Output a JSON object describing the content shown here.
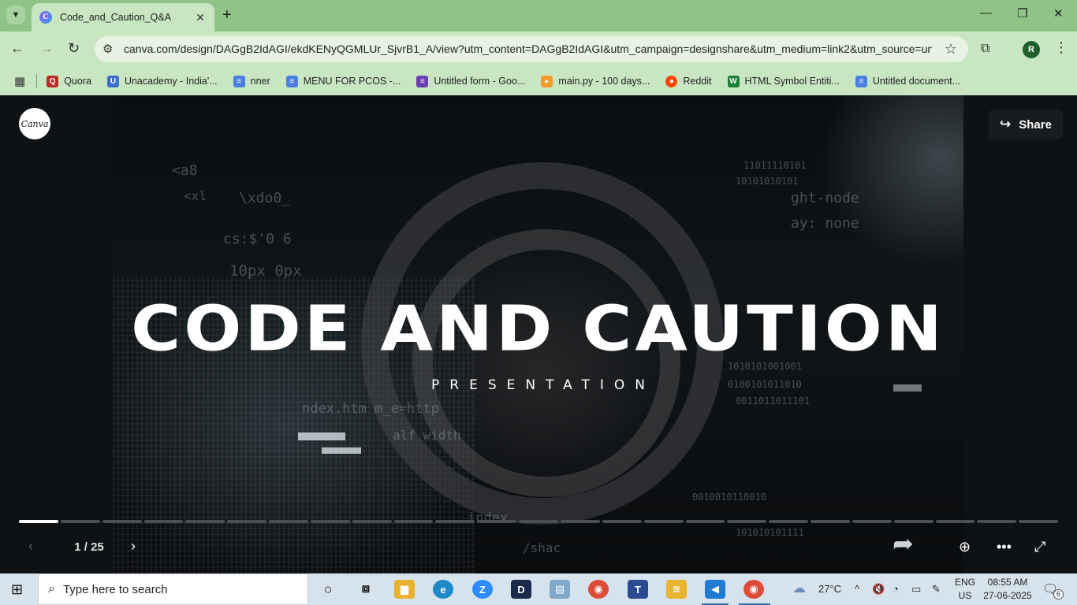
{
  "browser": {
    "tab": {
      "title": "Code_and_Caution_Q&A"
    },
    "url": "canva.com/design/DAGgB2IdAGI/ekdKENyQGMLUr_SjvrB1_A/view?utm_content=DAGgB2IdAGI&utm_campaign=designshare&utm_medium=link2&utm_source=un...",
    "profile_initial": "R",
    "bookmarks": [
      {
        "label": "Quora",
        "color": "#b92b27",
        "glyph": "Q"
      },
      {
        "label": "Unacademy - India'...",
        "color": "#3c6ec8",
        "glyph": "U"
      },
      {
        "label": "nner",
        "color": "#4a7fe0",
        "glyph": "≡"
      },
      {
        "label": "MENU FOR PCOS -...",
        "color": "#4a7fe0",
        "glyph": "≡"
      },
      {
        "label": "Untitled form - Goo...",
        "color": "#6c3fb5",
        "glyph": "≡"
      },
      {
        "label": "main.py - 100 days...",
        "color": "#f39c2a",
        "glyph": "▸"
      },
      {
        "label": "Reddit",
        "color": "#ff4500",
        "glyph": "●"
      },
      {
        "label": "HTML Symbol Entiti...",
        "color": "#1a7f37",
        "glyph": "W"
      },
      {
        "label": "Untitled document...",
        "color": "#4a7fe0",
        "glyph": "≡"
      }
    ]
  },
  "viewer": {
    "logo_text": "Canva",
    "share_label": "Share",
    "slide": {
      "title": "CODE AND CAUTION",
      "subtitle": "PRESENTATION"
    },
    "page": {
      "current": 1,
      "total": 25,
      "label": "1 / 25"
    }
  },
  "taskbar": {
    "search_placeholder": "Type here to search",
    "weather": "27°C",
    "lang_line1": "ENG",
    "lang_line2": "US",
    "time": "08:55 AM",
    "date": "27-06-2025",
    "notifications": "6",
    "apps": [
      {
        "name": "task-view",
        "color": "#333333",
        "glyph": "▭"
      },
      {
        "name": "file-explorer",
        "color": "#e8b130",
        "glyph": "▆"
      },
      {
        "name": "edge",
        "color": "#1e88c8",
        "glyph": "e"
      },
      {
        "name": "zoom",
        "color": "#2d8cff",
        "glyph": "Z"
      },
      {
        "name": "dev-tool",
        "color": "#1a2a4a",
        "glyph": "D"
      },
      {
        "name": "notepad-app",
        "color": "#7fa8c9",
        "glyph": "▤"
      },
      {
        "name": "chrome",
        "color": "#dd4b39",
        "glyph": "◉"
      },
      {
        "name": "text-editor",
        "color": "#2a4b8f",
        "glyph": "T"
      },
      {
        "name": "stack-app",
        "color": "#e9b430",
        "glyph": "≋"
      },
      {
        "name": "vscode",
        "color": "#1f7ad4",
        "glyph": "◀"
      },
      {
        "name": "chrome-profile",
        "color": "#dd4b39",
        "glyph": "◉"
      }
    ]
  }
}
